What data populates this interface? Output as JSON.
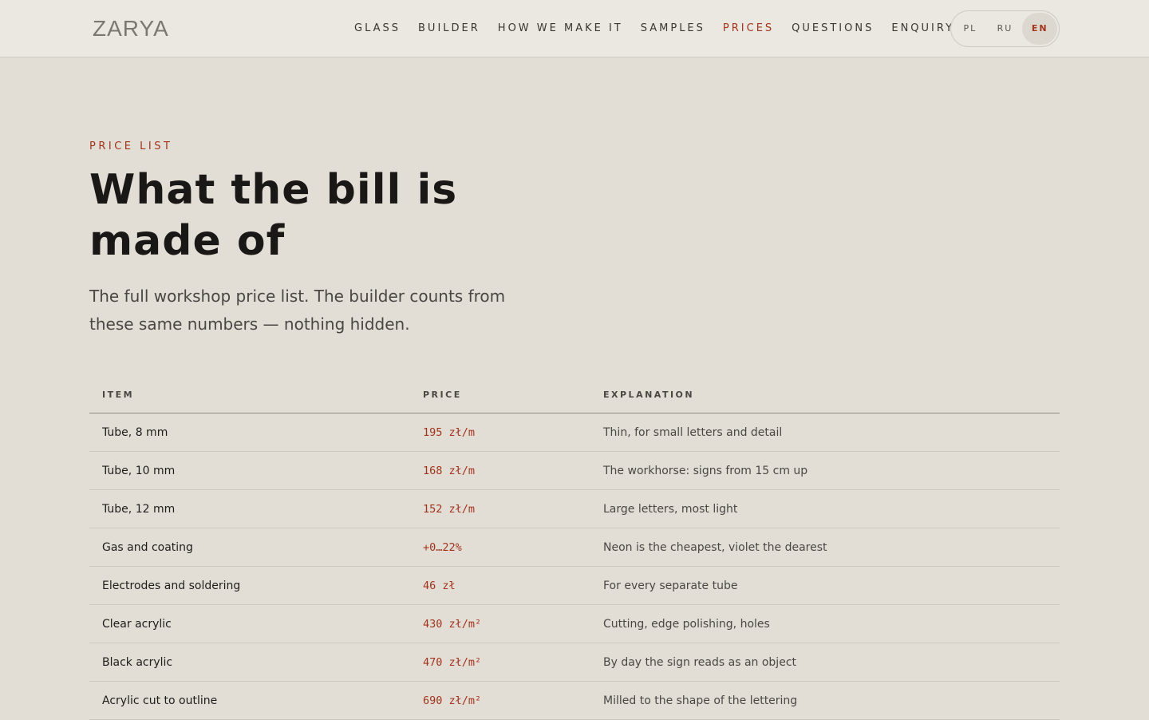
{
  "brand": {
    "logo": "ZARYA"
  },
  "nav": {
    "items": [
      {
        "label": "GLASS",
        "active": false
      },
      {
        "label": "BUILDER",
        "active": false
      },
      {
        "label": "HOW WE MAKE IT",
        "active": false
      },
      {
        "label": "SAMPLES",
        "active": false
      },
      {
        "label": "PRICES",
        "active": true
      },
      {
        "label": "QUESTIONS",
        "active": false
      },
      {
        "label": "ENQUIRY",
        "active": false
      }
    ]
  },
  "language": {
    "options": [
      "PL",
      "RU",
      "EN"
    ],
    "selected": "EN"
  },
  "hero": {
    "eyebrow": "PRICE LIST",
    "title": "What the bill is made of",
    "lead": "The full workshop price list. The builder counts from these same numbers — nothing hidden."
  },
  "price_table": {
    "headers": {
      "item": "ITEM",
      "price": "PRICE",
      "explanation": "EXPLANATION"
    },
    "rows": [
      {
        "item": "Tube, 8 mm",
        "price": "195 zł/m",
        "explanation": "Thin, for small letters and detail"
      },
      {
        "item": "Tube, 10 mm",
        "price": "168 zł/m",
        "explanation": "The workhorse: signs from 15 cm up"
      },
      {
        "item": "Tube, 12 mm",
        "price": "152 zł/m",
        "explanation": "Large letters, most light"
      },
      {
        "item": "Gas and coating",
        "price": "+0…22%",
        "explanation": "Neon is the cheapest, violet the dearest"
      },
      {
        "item": "Electrodes and soldering",
        "price": "46 zł",
        "explanation": "For every separate tube"
      },
      {
        "item": "Clear acrylic",
        "price": "430 zł/m²",
        "explanation": "Cutting, edge polishing, holes"
      },
      {
        "item": "Black acrylic",
        "price": "470 zł/m²",
        "explanation": "By day the sign reads as an object"
      },
      {
        "item": "Acrylic cut to outline",
        "price": "690 zł/m²",
        "explanation": "Milled to the shape of the lettering"
      }
    ]
  },
  "colors": {
    "background": "#e2ded6",
    "topbar": "#ebe8e2",
    "accent": "#a3341c",
    "text": "#1f1d1a"
  }
}
